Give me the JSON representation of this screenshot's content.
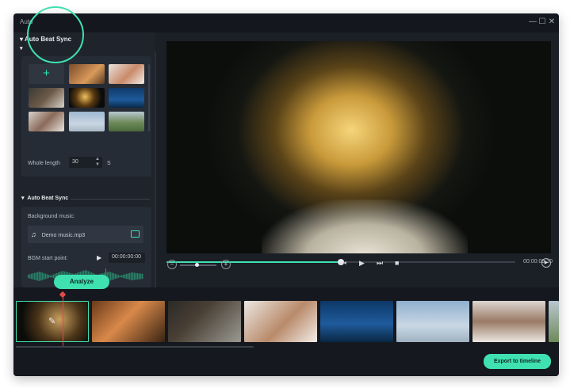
{
  "window": {
    "title": "Auto",
    "controls": {
      "minimize": "—",
      "maximize": "☐",
      "close": "✕"
    }
  },
  "sidebar": {
    "section1_title": "Auto Beat Sync",
    "add_media_symbol": "+",
    "whole_length_label": "Whole length",
    "whole_length_value": "30",
    "whole_length_unit": "S",
    "section2_title": "Auto Beat Sync",
    "background_music_label": "Background music:",
    "music_file": "Demo music.mp3",
    "bgm_start_label": "BGM start point:",
    "bgm_start_value": "00:00:00:00",
    "analyze_button": "Analyze"
  },
  "preview": {
    "progress": 0.5,
    "timecode": "00:00:09:30"
  },
  "controls": {
    "zoom_level": 0.45
  },
  "timeline": {
    "export_button": "Export to timeline",
    "playhead_position_label": ""
  },
  "colors": {
    "accent": "#3fe1b0",
    "window_bg": "#1b1f26",
    "panel_bg": "#262c35",
    "timeline_bg": "#15181e"
  }
}
